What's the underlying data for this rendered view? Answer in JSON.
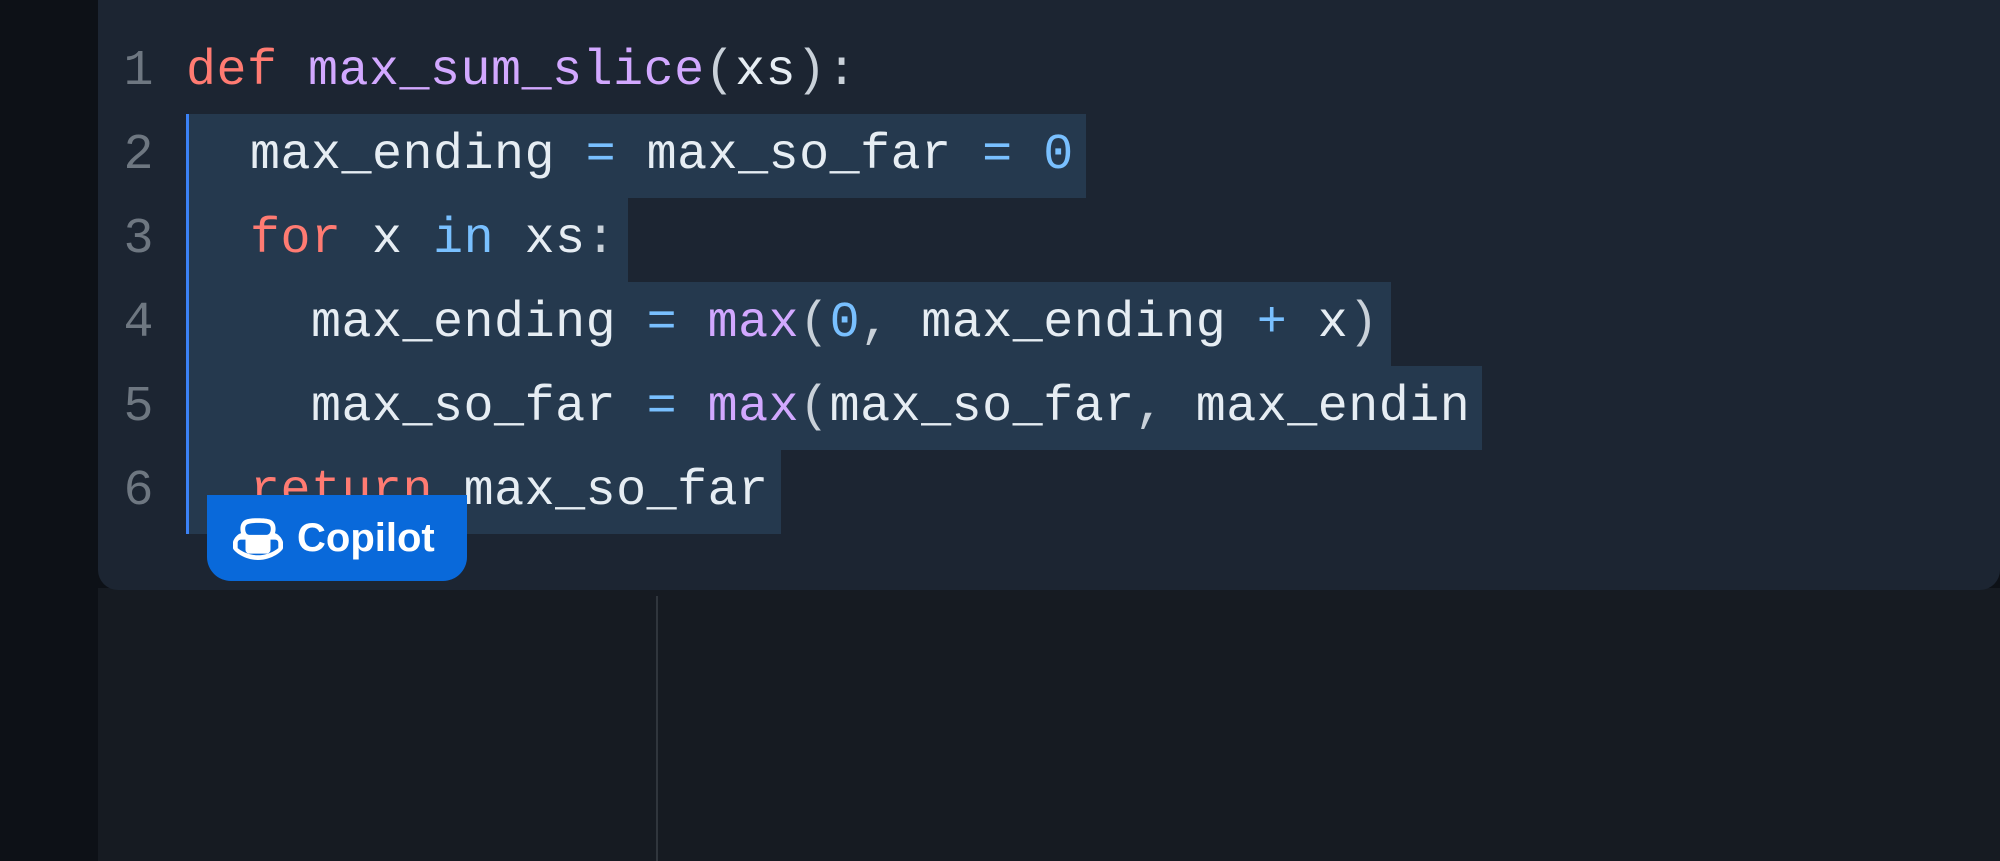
{
  "editor": {
    "lines": [
      {
        "num": "1",
        "tokens": [
          {
            "t": "def ",
            "c": "kw-def"
          },
          {
            "t": "max_sum_slice",
            "c": "fn-name"
          },
          {
            "t": "(",
            "c": "paren"
          },
          {
            "t": "xs",
            "c": "var"
          },
          {
            "t": ")",
            "c": "paren"
          },
          {
            "t": ":",
            "c": "colon"
          }
        ],
        "suggestion": false
      },
      {
        "num": "2",
        "indent": "  ",
        "tokens": [
          {
            "t": "max_ending ",
            "c": "var"
          },
          {
            "t": "=",
            "c": "op"
          },
          {
            "t": " max_so_far ",
            "c": "var"
          },
          {
            "t": "=",
            "c": "op"
          },
          {
            "t": " ",
            "c": "plain"
          },
          {
            "t": "0",
            "c": "num"
          }
        ],
        "suggestion": true
      },
      {
        "num": "3",
        "indent": "  ",
        "tokens": [
          {
            "t": "for ",
            "c": "kw-for"
          },
          {
            "t": "x ",
            "c": "var"
          },
          {
            "t": "in ",
            "c": "kw-in"
          },
          {
            "t": "xs",
            "c": "var"
          },
          {
            "t": ":",
            "c": "colon"
          }
        ],
        "suggestion": true
      },
      {
        "num": "4",
        "indent": "    ",
        "tokens": [
          {
            "t": "max_ending ",
            "c": "var"
          },
          {
            "t": "=",
            "c": "op"
          },
          {
            "t": " ",
            "c": "plain"
          },
          {
            "t": "max",
            "c": "fn-call"
          },
          {
            "t": "(",
            "c": "paren"
          },
          {
            "t": "0",
            "c": "num"
          },
          {
            "t": ",",
            "c": "plain"
          },
          {
            "t": " max_ending ",
            "c": "var"
          },
          {
            "t": "+",
            "c": "op"
          },
          {
            "t": " x",
            "c": "var"
          },
          {
            "t": ")",
            "c": "paren"
          }
        ],
        "suggestion": true
      },
      {
        "num": "5",
        "indent": "    ",
        "tokens": [
          {
            "t": "max_so_far ",
            "c": "var"
          },
          {
            "t": "=",
            "c": "op"
          },
          {
            "t": " ",
            "c": "plain"
          },
          {
            "t": "max",
            "c": "fn-call"
          },
          {
            "t": "(",
            "c": "paren"
          },
          {
            "t": "max_so_far",
            "c": "var"
          },
          {
            "t": ",",
            "c": "plain"
          },
          {
            "t": " max_endin",
            "c": "var"
          }
        ],
        "suggestion": true
      },
      {
        "num": "6",
        "indent": "  ",
        "tokens": [
          {
            "t": "return ",
            "c": "kw-return"
          },
          {
            "t": "max_so_far",
            "c": "var"
          }
        ],
        "suggestion": true
      }
    ]
  },
  "copilot": {
    "label": "Copilot"
  }
}
